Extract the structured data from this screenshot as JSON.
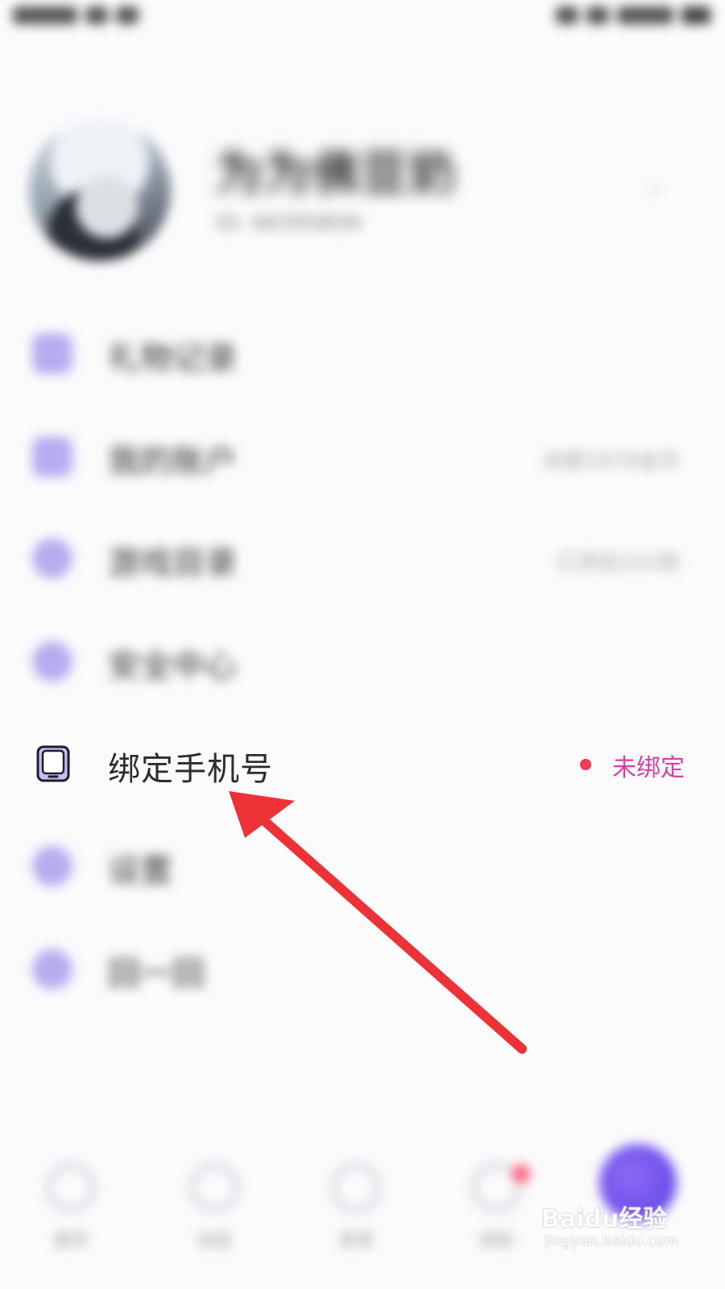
{
  "colors": {
    "background": "#fbfbfc",
    "accent_purple": "#7b61ff",
    "menu_icon": "#b8abf0",
    "status_dot": "#ee3b57",
    "status_text": "#d63fa6",
    "annotation_arrow": "#ec3237"
  },
  "profile": {
    "name": "为为佛豆奶",
    "id": "ID: 6839SBSN"
  },
  "menu": [
    {
      "label": "礼物记录",
      "icon": "gift-icon",
      "value": ""
    },
    {
      "label": "我的账户",
      "icon": "wallet-icon",
      "value": "余额1878金币"
    },
    {
      "label": "游戏目录",
      "icon": "game-icon",
      "value": "已添加101款"
    },
    {
      "label": "安全中心",
      "icon": "shield-icon",
      "value": ""
    }
  ],
  "bind_phone": {
    "label": "绑定手机号",
    "status": "未绑定",
    "icon": "phone-icon"
  },
  "menu_after": [
    {
      "label": "设置",
      "icon": "settings-icon"
    },
    {
      "label": "回一回",
      "icon": "feedback-icon"
    }
  ],
  "bottom_nav": [
    {
      "label": "首页",
      "icon": "home-icon"
    },
    {
      "label": "动态",
      "icon": "feed-icon"
    },
    {
      "label": "发现",
      "icon": "discover-icon"
    },
    {
      "label": "消息",
      "icon": "message-icon",
      "badge": true
    },
    {
      "label": "我的",
      "icon": "profile-fab-icon"
    }
  ],
  "watermark": {
    "main": "Baidu经验",
    "sub": "jingyan.baidu.com"
  }
}
